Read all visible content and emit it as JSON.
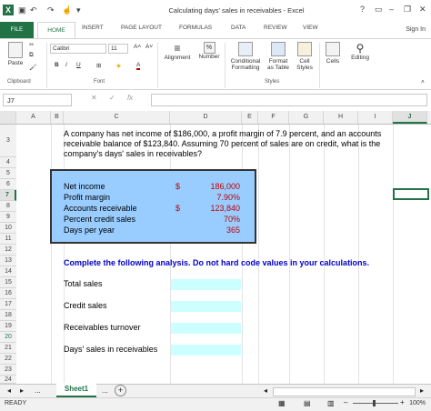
{
  "window": {
    "title": "Calculating days' sales in receivables - Excel",
    "help": "?",
    "sign_in": "Sign In"
  },
  "ribbon": {
    "tabs": [
      "FILE",
      "HOME",
      "INSERT",
      "PAGE LAYOUT",
      "FORMULAS",
      "DATA",
      "REVIEW",
      "VIEW"
    ],
    "paste_label": "Paste",
    "font_name": "Calibri",
    "font_size": "11",
    "bold": "B",
    "italic": "I",
    "underline": "U",
    "font_color_letter": "A",
    "alignment_label": "Alignment",
    "number_label": "Number",
    "percent_symbol": "%",
    "conditional_formatting_label": "Conditional Formatting",
    "format_as_table_label": "Format as Table",
    "cell_styles_label": "Cell Styles",
    "cells_label": "Cells",
    "editing_label": "Editing",
    "groups": {
      "clipboard": "Clipboard",
      "font": "Font",
      "styles": "Styles"
    }
  },
  "formula_bar": {
    "name_box": "J7",
    "fx": "fx",
    "cancel": "✕",
    "enter": "✓",
    "value": ""
  },
  "columns": [
    "A",
    "B",
    "C",
    "D",
    "E",
    "F",
    "G",
    "H",
    "I",
    "J"
  ],
  "rows": [
    "3",
    "4",
    "5",
    "6",
    "7",
    "8",
    "9",
    "10",
    "11",
    "12",
    "13",
    "14",
    "15",
    "16",
    "17",
    "18",
    "19",
    "20",
    "21",
    "22",
    "23",
    "24"
  ],
  "sheet": {
    "question": "A company has net income of $186,000, a profit margin of 7.9 percent, and an accounts receivable balance of $123,840. Assuming 70 percent of sales are on credit, what is the company's days' sales in receivables?",
    "data_items": [
      {
        "label": "Net income",
        "symbol": "$",
        "value": "186,000"
      },
      {
        "label": "Profit margin",
        "symbol": "",
        "value": "7.90%"
      },
      {
        "label": "Accounts receivable",
        "symbol": "$",
        "value": "123,840"
      },
      {
        "label": "Percent credit sales",
        "symbol": "",
        "value": "70%"
      },
      {
        "label": "Days per year",
        "symbol": "",
        "value": "365"
      }
    ],
    "instruction": "Complete the following analysis. Do not hard code values in your calculations.",
    "analysis": [
      "Total sales",
      "Credit sales",
      "Receivables turnover",
      "Days' sales in receivables"
    ]
  },
  "tabs_bar": {
    "sheet_name": "Sheet1",
    "ellipsis": "...",
    "add": "+"
  },
  "status": {
    "ready": "READY",
    "zoom": "100%"
  },
  "colors": {
    "excel_green": "#217346",
    "data_box_fill": "#99ccff",
    "input_fill": "#ccffff",
    "value_red": "#c00000",
    "instruction_blue": "#0000cc"
  }
}
